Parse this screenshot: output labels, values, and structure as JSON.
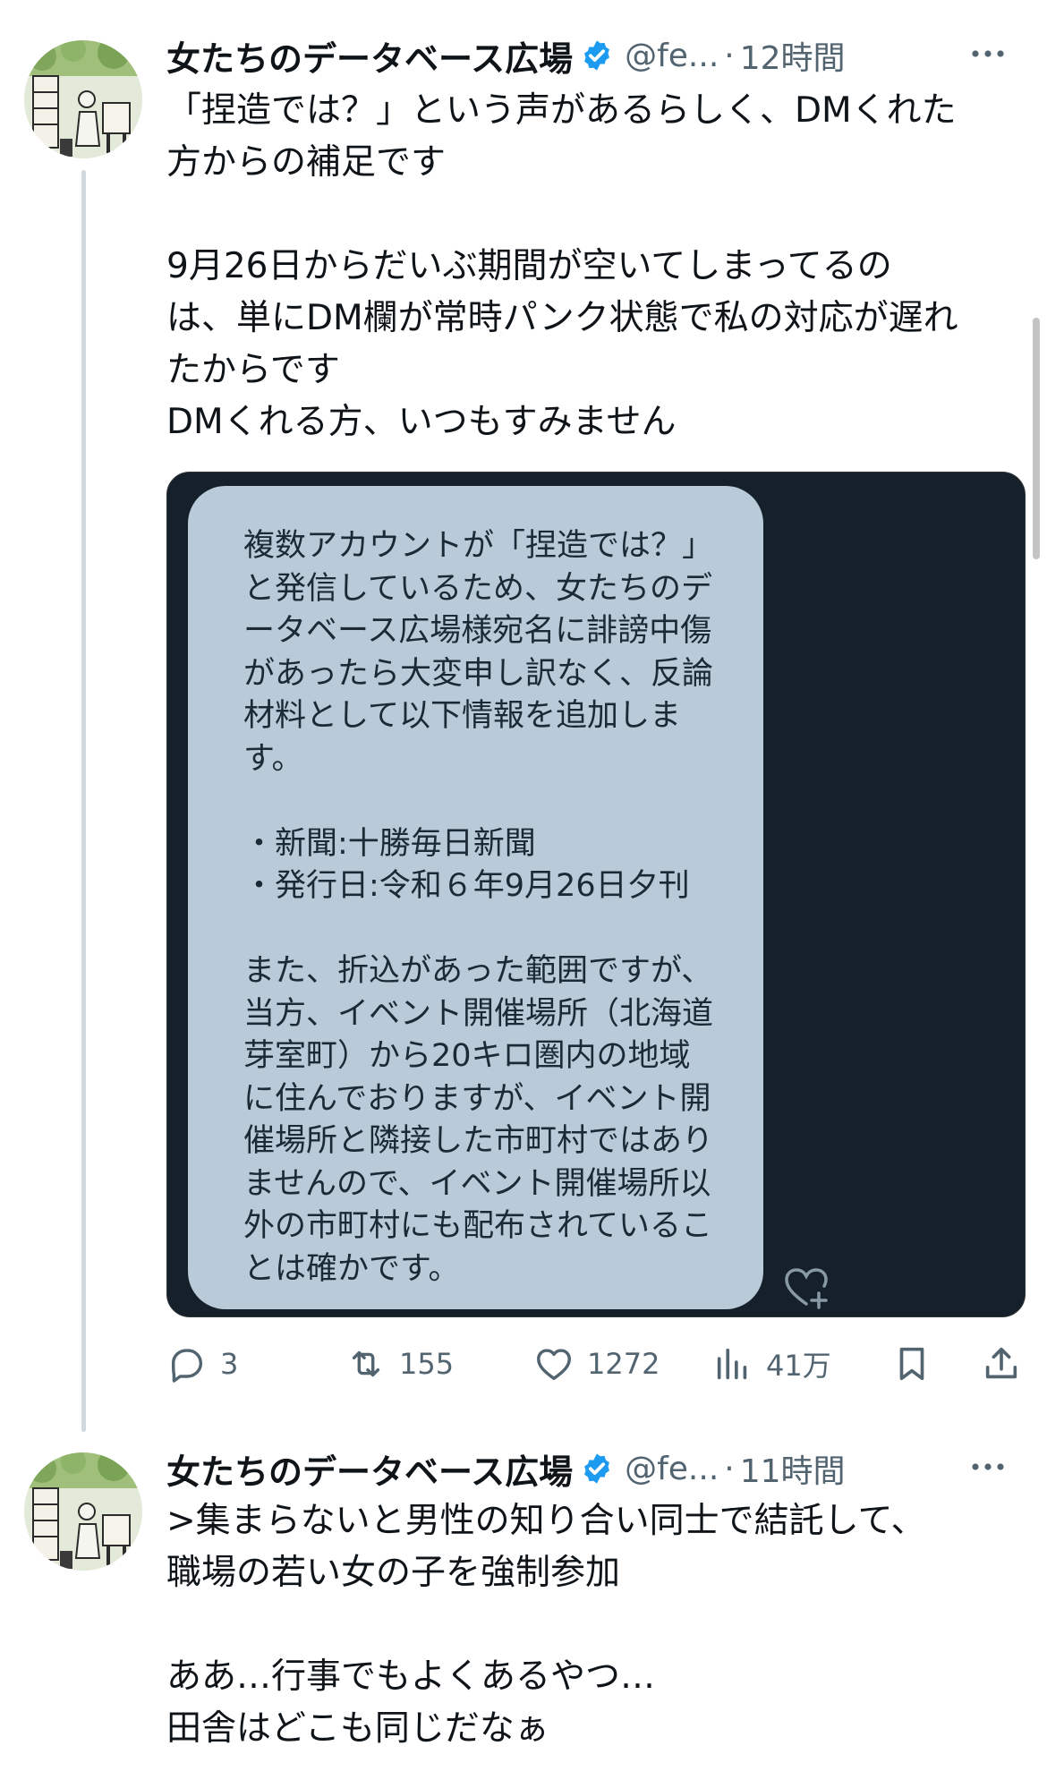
{
  "tweets": [
    {
      "display_name": "女たちのデータベース広場",
      "handle": "@fe...",
      "separator": "·",
      "time": "12時間",
      "text_lines": [
        "「捏造では？」という声があるらしく、DMくれた",
        "方からの補足です",
        "",
        "9月26日からだいぶ期間が空いてしまってるの",
        "は、単にDM欄が常時パンク状態で私の対応が遅れ",
        "たからです",
        "DMくれる方、いつもすみません"
      ],
      "media_bubble_lines": [
        "複数アカウントが「捏造では？」",
        "と発信しているため、女たちのデ",
        "ータベース広場様宛名に誹謗中傷",
        "があったら大変申し訳なく、反論",
        "材料として以下情報を追加しま",
        "す。",
        "",
        "・新聞:十勝毎日新聞",
        "・発行日:令和６年9月26日夕刊",
        "",
        "また、折込があった範囲ですが、",
        "当方、イベント開催場所（北海道",
        "芽室町）から20キロ圏内の地域",
        "に住んでおりますが、イベント開",
        "催場所と隣接した市町村ではあり",
        "ませんので、イベント開催場所以",
        "外の市町村にも配布されているこ",
        "とは確かです。"
      ],
      "actions": {
        "replies": "3",
        "retweets": "155",
        "likes": "1272",
        "views": "41万"
      }
    },
    {
      "display_name": "女たちのデータベース広場",
      "handle": "@fe...",
      "separator": "·",
      "time": "11時間",
      "text_lines": [
        ">集まらないと男性の知り合い同士で結託して、",
        "職場の若い女の子を強制参加",
        "",
        "ああ…行事でもよくあるやつ…",
        "田舎はどこも同じだなぁ"
      ]
    }
  ],
  "colors": {
    "text": "#0f1419",
    "secondary": "#536471",
    "verified_blue": "#1d9bf0",
    "media_bg": "#15202b",
    "bubble_bg": "#b9cbd9",
    "thread_line": "#cfd9de"
  },
  "icons": [
    "verified-badge-icon",
    "more-icon",
    "reply-icon",
    "retweet-icon",
    "like-icon",
    "views-icon",
    "bookmark-icon",
    "share-icon",
    "heart-plus-icon"
  ]
}
